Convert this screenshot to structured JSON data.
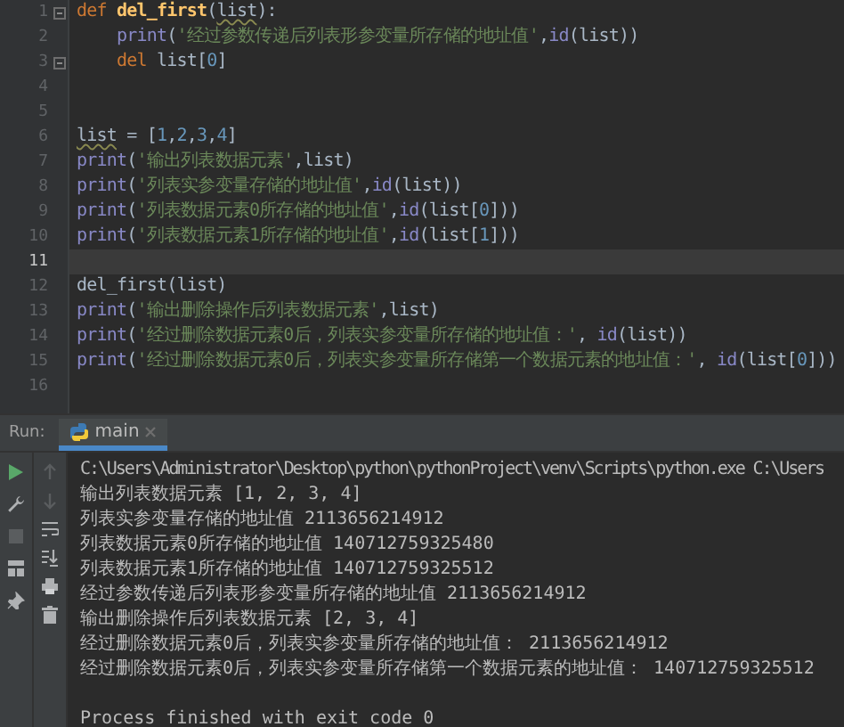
{
  "editor": {
    "lines": [
      {
        "number": "1",
        "fold": true,
        "current": false,
        "tokens": [
          {
            "kind": "keyword",
            "text": "def "
          },
          {
            "kind": "funcname",
            "text": "del_first"
          },
          {
            "kind": "plain",
            "text": "("
          },
          {
            "kind": "warn",
            "text": "list"
          },
          {
            "kind": "plain",
            "text": "):"
          }
        ]
      },
      {
        "number": "2",
        "fold": false,
        "current": false,
        "tokens": [
          {
            "kind": "builtin",
            "text": "    print"
          },
          {
            "kind": "plain",
            "text": "("
          },
          {
            "kind": "string",
            "text": "'经过参数传递后列表形参变量所存储的地址值'"
          },
          {
            "kind": "plain",
            "text": ","
          },
          {
            "kind": "builtin",
            "text": "id"
          },
          {
            "kind": "plain",
            "text": "(list))"
          }
        ]
      },
      {
        "number": "3",
        "fold": true,
        "current": false,
        "tokens": [
          {
            "kind": "keyword",
            "text": "    del "
          },
          {
            "kind": "plain",
            "text": "list["
          },
          {
            "kind": "number",
            "text": "0"
          },
          {
            "kind": "plain",
            "text": "]"
          }
        ]
      },
      {
        "number": "4",
        "fold": false,
        "current": false
      },
      {
        "number": "5",
        "fold": false,
        "current": false
      },
      {
        "number": "6",
        "fold": false,
        "current": false,
        "tokens": [
          {
            "kind": "warn",
            "text": "list"
          },
          {
            "kind": "plain",
            "text": " = ["
          },
          {
            "kind": "number",
            "text": "1"
          },
          {
            "kind": "plain",
            "text": ","
          },
          {
            "kind": "number",
            "text": "2"
          },
          {
            "kind": "plain",
            "text": ","
          },
          {
            "kind": "number",
            "text": "3"
          },
          {
            "kind": "plain",
            "text": ","
          },
          {
            "kind": "number",
            "text": "4"
          },
          {
            "kind": "plain",
            "text": "]"
          }
        ]
      },
      {
        "number": "7",
        "fold": false,
        "current": false,
        "tokens": [
          {
            "kind": "builtin",
            "text": "print"
          },
          {
            "kind": "plain",
            "text": "("
          },
          {
            "kind": "string",
            "text": "'输出列表数据元素'"
          },
          {
            "kind": "plain",
            "text": ",list)"
          }
        ]
      },
      {
        "number": "8",
        "fold": false,
        "current": false,
        "tokens": [
          {
            "kind": "builtin",
            "text": "print"
          },
          {
            "kind": "plain",
            "text": "("
          },
          {
            "kind": "string",
            "text": "'列表实参变量存储的地址值'"
          },
          {
            "kind": "plain",
            "text": ","
          },
          {
            "kind": "builtin",
            "text": "id"
          },
          {
            "kind": "plain",
            "text": "(list))"
          }
        ]
      },
      {
        "number": "9",
        "fold": false,
        "current": false,
        "tokens": [
          {
            "kind": "builtin",
            "text": "print"
          },
          {
            "kind": "plain",
            "text": "("
          },
          {
            "kind": "string",
            "text": "'列表数据元素0所存储的地址值'"
          },
          {
            "kind": "plain",
            "text": ","
          },
          {
            "kind": "builtin",
            "text": "id"
          },
          {
            "kind": "plain",
            "text": "(list["
          },
          {
            "kind": "number",
            "text": "0"
          },
          {
            "kind": "plain",
            "text": "]))"
          }
        ]
      },
      {
        "number": "10",
        "fold": false,
        "current": false,
        "tokens": [
          {
            "kind": "builtin",
            "text": "print"
          },
          {
            "kind": "plain",
            "text": "("
          },
          {
            "kind": "string",
            "text": "'列表数据元素1所存储的地址值'"
          },
          {
            "kind": "plain",
            "text": ","
          },
          {
            "kind": "builtin",
            "text": "id"
          },
          {
            "kind": "plain",
            "text": "(list["
          },
          {
            "kind": "number",
            "text": "1"
          },
          {
            "kind": "plain",
            "text": "]))"
          }
        ]
      },
      {
        "number": "11",
        "fold": false,
        "current": true
      },
      {
        "number": "12",
        "fold": false,
        "current": false,
        "tokens": [
          {
            "kind": "plain",
            "text": "del_first(list)"
          }
        ]
      },
      {
        "number": "13",
        "fold": false,
        "current": false,
        "tokens": [
          {
            "kind": "builtin",
            "text": "print"
          },
          {
            "kind": "plain",
            "text": "("
          },
          {
            "kind": "string",
            "text": "'输出删除操作后列表数据元素'"
          },
          {
            "kind": "plain",
            "text": ",list)"
          }
        ]
      },
      {
        "number": "14",
        "fold": false,
        "current": false,
        "tokens": [
          {
            "kind": "builtin",
            "text": "print"
          },
          {
            "kind": "plain",
            "text": "("
          },
          {
            "kind": "string",
            "text": "'经过删除数据元素0后，列表实参变量所存储的地址值：'"
          },
          {
            "kind": "plain",
            "text": ", "
          },
          {
            "kind": "builtin",
            "text": "id"
          },
          {
            "kind": "plain",
            "text": "(list))"
          }
        ]
      },
      {
        "number": "15",
        "fold": false,
        "current": false,
        "tokens": [
          {
            "kind": "builtin",
            "text": "print"
          },
          {
            "kind": "plain",
            "text": "("
          },
          {
            "kind": "string",
            "text": "'经过删除数据元素0后，列表实参变量所存储第一个数据元素的地址值：'"
          },
          {
            "kind": "plain",
            "text": ", "
          },
          {
            "kind": "builtin",
            "text": "id"
          },
          {
            "kind": "plain",
            "text": "(list["
          },
          {
            "kind": "number",
            "text": "0"
          },
          {
            "kind": "plain",
            "text": "]))"
          }
        ]
      },
      {
        "number": "16",
        "fold": false,
        "current": false
      }
    ]
  },
  "run_panel": {
    "label": "Run:",
    "tabs": [
      {
        "label": "main",
        "selected": true
      }
    ],
    "output": [
      {
        "kind": "command",
        "text": "C:\\Users\\Administrator\\Desktop\\python\\pythonProject\\venv\\Scripts\\python.exe C:\\Users"
      },
      {
        "kind": "output",
        "text": "输出列表数据元素 [1, 2, 3, 4]"
      },
      {
        "kind": "output",
        "text": "列表实参变量存储的地址值 2113656214912"
      },
      {
        "kind": "output",
        "text": "列表数据元素0所存储的地址值 140712759325480"
      },
      {
        "kind": "output",
        "text": "列表数据元素1所存储的地址值 140712759325512"
      },
      {
        "kind": "output",
        "text": "经过参数传递后列表形参变量所存储的地址值 2113656214912"
      },
      {
        "kind": "output",
        "text": "输出删除操作后列表数据元素 [2, 3, 4]"
      },
      {
        "kind": "output",
        "text": "经过删除数据元素0后，列表实参变量所存储的地址值： 2113656214912"
      },
      {
        "kind": "output",
        "text": "经过删除数据元素0后，列表实参变量所存储第一个数据元素的地址值： 140712759325512"
      },
      {
        "kind": "blank"
      },
      {
        "kind": "output",
        "text": "Process finished with exit code 0"
      }
    ]
  }
}
